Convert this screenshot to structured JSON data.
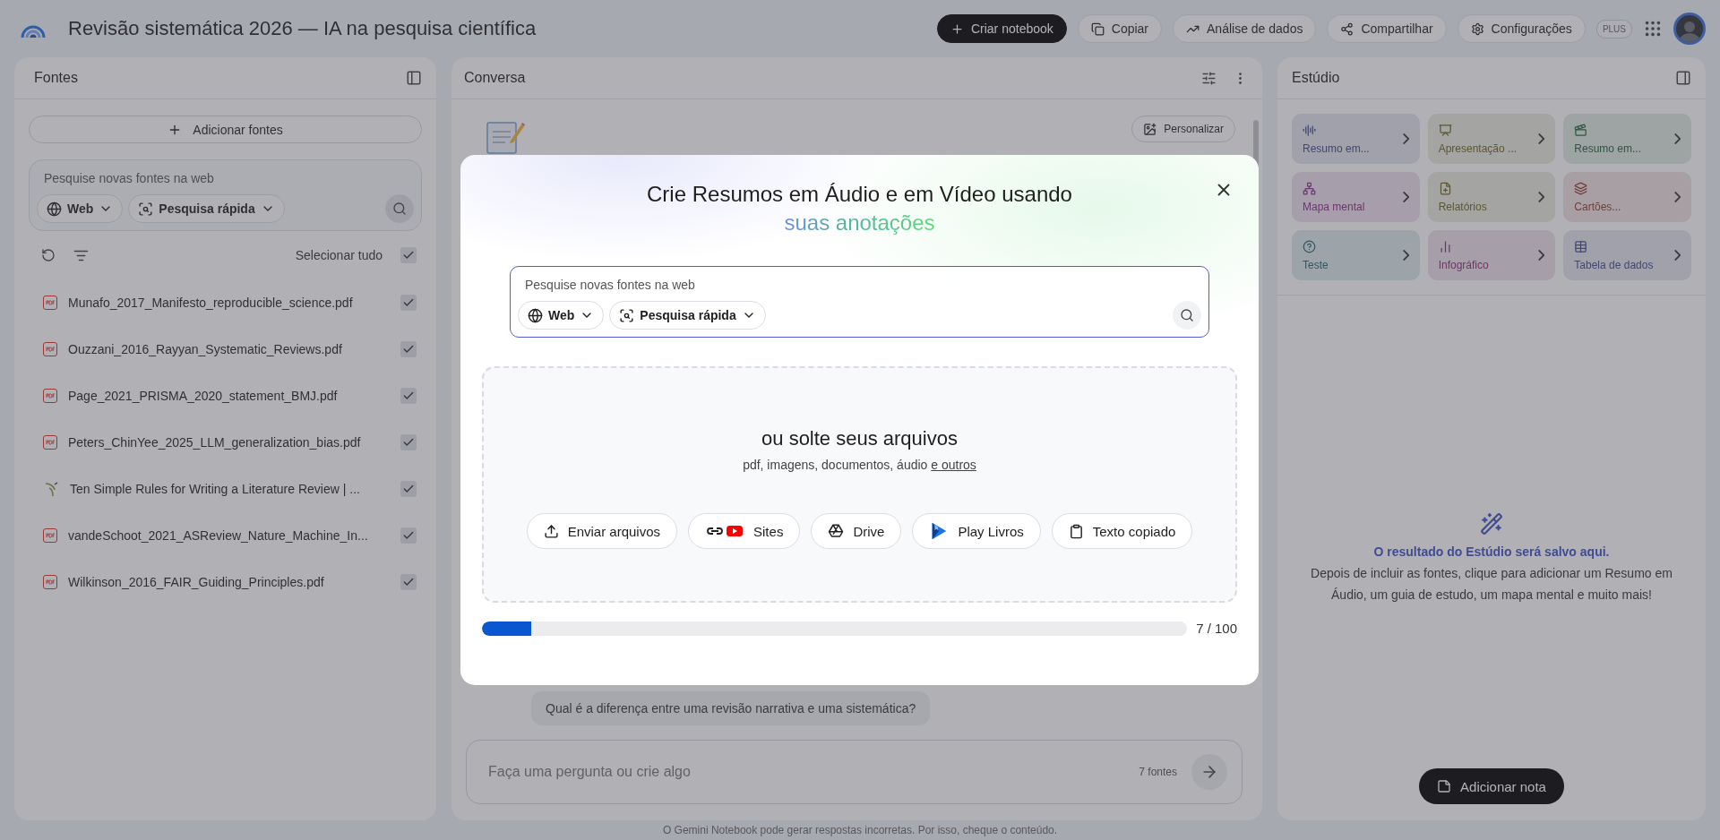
{
  "header": {
    "title": "Revisão sistemática 2026 — IA na pesquisa científica",
    "actions": [
      {
        "kind": "create",
        "label": "Criar notebook"
      },
      {
        "kind": "copy",
        "label": "Copiar"
      },
      {
        "kind": "analytics",
        "label": "Análise de dados"
      },
      {
        "kind": "share",
        "label": "Compartilhar"
      },
      {
        "kind": "settings",
        "label": "Configurações"
      }
    ],
    "plan_badge": "PLUS"
  },
  "sources": {
    "title": "Fontes",
    "add_button": "Adicionar fontes",
    "search": {
      "placeholder": "Pesquise novas fontes na web",
      "scope": "Web",
      "mode": "Pesquisa rápida"
    },
    "select_all": {
      "label": "Selecionar tudo",
      "checked": true
    },
    "items": [
      {
        "kind": "pdf",
        "name": "Munafo_2017_Manifesto_reproducible_science.pdf",
        "checked": true
      },
      {
        "kind": "pdf",
        "name": "Ouzzani_2016_Rayyan_Systematic_Reviews.pdf",
        "checked": true
      },
      {
        "kind": "pdf",
        "name": "Page_2021_PRISMA_2020_statement_BMJ.pdf",
        "checked": true
      },
      {
        "kind": "pdf",
        "name": "Peters_ChinYee_2025_LLM_generalization_bias.pdf",
        "checked": true
      },
      {
        "kind": "web",
        "name": "Ten Simple Rules for Writing a Literature Review | ...",
        "checked": true
      },
      {
        "kind": "pdf",
        "name": "vandeSchoot_2021_ASReview_Nature_Machine_In...",
        "checked": true
      },
      {
        "kind": "pdf",
        "name": "Wilkinson_2016_FAIR_Guiding_Principles.pdf",
        "checked": true
      }
    ]
  },
  "chat": {
    "title": "Conversa",
    "customize_button": "Personalizar",
    "user_message": "Qual é a diferença entre uma revisão narrativa e uma sistemática?",
    "input": {
      "placeholder": "Faça uma pergunta ou crie algo",
      "source_count": "7 fontes"
    }
  },
  "studio": {
    "title": "Estúdio",
    "cards": [
      {
        "kind": "audio",
        "label": "Resumo em..."
      },
      {
        "kind": "slides",
        "label": "Apresentação ..."
      },
      {
        "kind": "video",
        "label": "Resumo em..."
      },
      {
        "kind": "mindmap",
        "label": "Mapa mental"
      },
      {
        "kind": "report",
        "label": "Relatórios"
      },
      {
        "kind": "flashcards",
        "label": "Cartões..."
      },
      {
        "kind": "quiz",
        "label": "Teste"
      },
      {
        "kind": "infographic",
        "label": "Infográfico"
      },
      {
        "kind": "table",
        "label": "Tabela de dados"
      }
    ],
    "empty_title": "O resultado do Estúdio será salvo aqui.",
    "empty_text": "Depois de incluir as fontes, clique para adicionar um Resumo em Áudio, um guia de estudo, um mapa mental e muito mais!",
    "add_note_button": "Adicionar nota"
  },
  "footer": "O Gemini Notebook pode gerar respostas incorretas. Por isso, cheque o conteúdo.",
  "dialog": {
    "title": "Crie Resumos em Áudio e em Vídeo usando",
    "subtitle": "suas anotações",
    "search": {
      "placeholder": "Pesquise novas fontes na web",
      "scope": "Web",
      "mode": "Pesquisa rápida"
    },
    "drop_title": "ou solte seus arquivos",
    "drop_text": "pdf, imagens, documentos, áudio",
    "drop_link": "e outros",
    "sources": [
      {
        "kind": "upload",
        "label": "Enviar arquivos"
      },
      {
        "kind": "sites",
        "label": "Sites"
      },
      {
        "kind": "drive",
        "label": "Drive"
      },
      {
        "kind": "books",
        "label": "Play Livros"
      },
      {
        "kind": "paste",
        "label": "Texto copiado"
      }
    ],
    "limit": {
      "level": 0.07,
      "reading": "7 / 100"
    }
  }
}
